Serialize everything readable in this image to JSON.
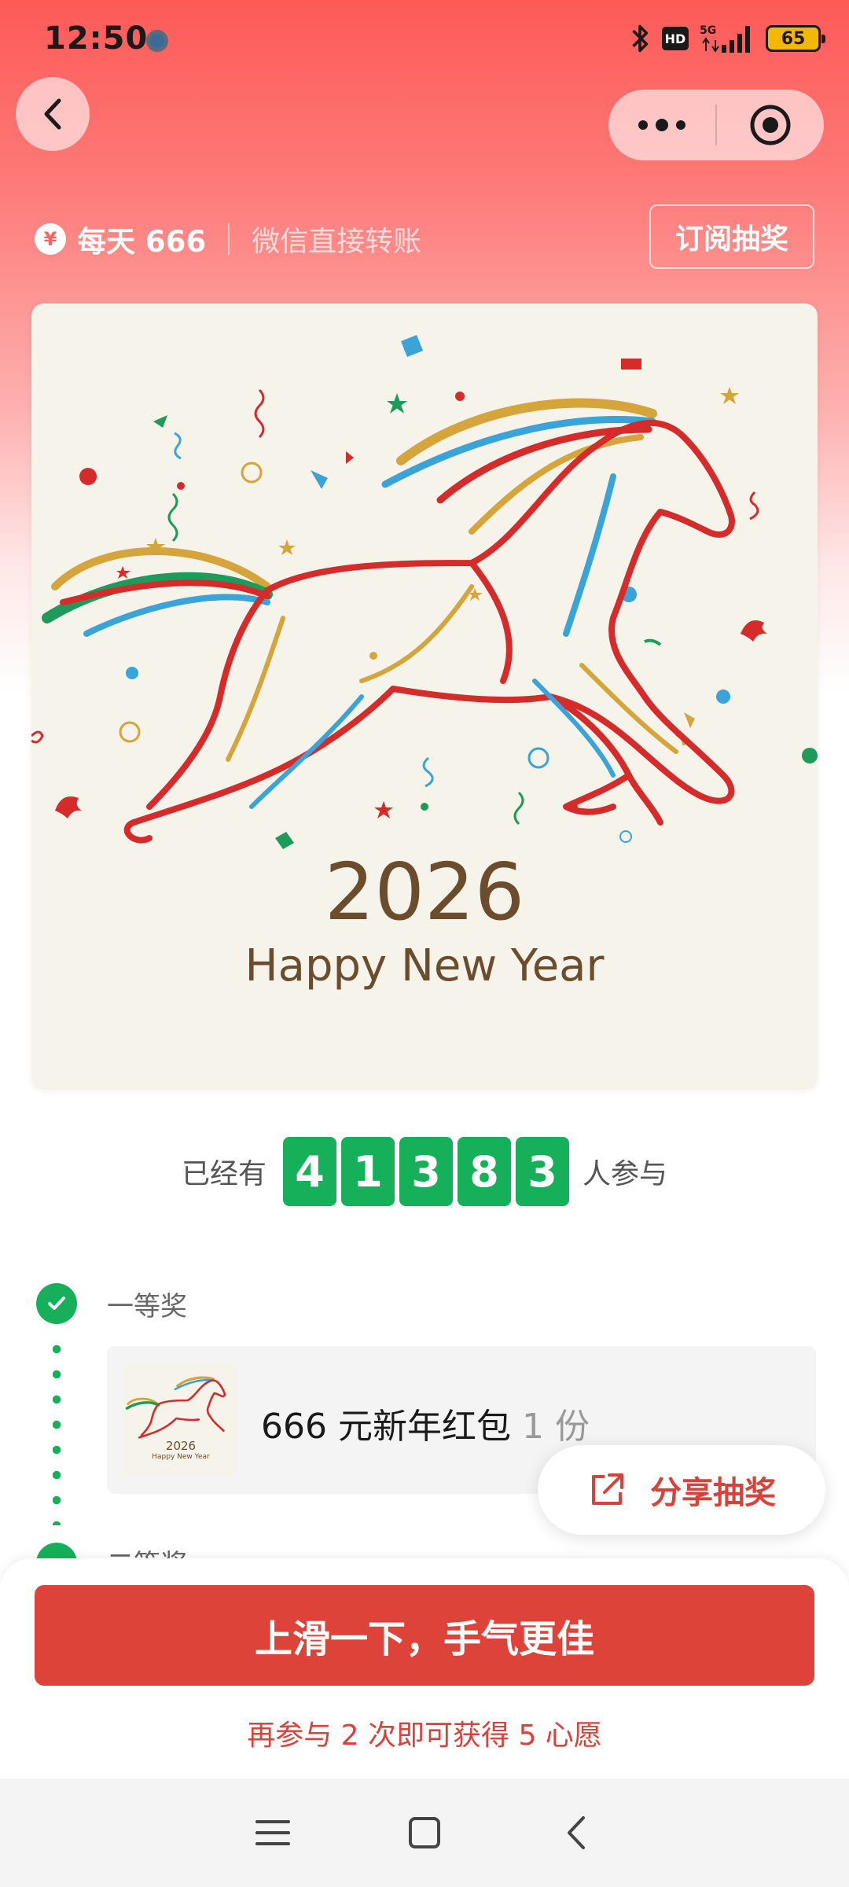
{
  "status_bar": {
    "time": "12:50",
    "network": "5G",
    "hd_badge": "HD",
    "battery": "65"
  },
  "header": {
    "back_icon": "chevron-left-icon",
    "more_icon": "more-dots-icon",
    "close_icon": "target-circle-icon"
  },
  "promo": {
    "icon": "yen-icon",
    "title": "每天 666",
    "subtitle": "微信直接转账",
    "subscribe_label": "订阅抽奖"
  },
  "poster": {
    "year": "2026",
    "greeting": "Happy New Year"
  },
  "counter": {
    "prefix": "已经有",
    "digits": [
      "4",
      "1",
      "3",
      "8",
      "3"
    ],
    "suffix": "人参与"
  },
  "prizes": [
    {
      "tier": "一等奖",
      "name": "666 元新年红包",
      "quantity": "1 份",
      "thumb_year": "2026",
      "thumb_greeting": "Happy New Year"
    },
    {
      "tier": "二等奖"
    }
  ],
  "share": {
    "icon": "share-icon",
    "label": "分享抽奖"
  },
  "cta": {
    "label": "上滑一下，手气更佳",
    "hint": "再参与 2 次即可获得 5 心愿"
  },
  "colors": {
    "brand_red": "#de4339",
    "accent_green": "#16b05a",
    "header_gradient_top": "#fd5a57"
  },
  "nav": {
    "menu_icon": "menu-icon",
    "home_icon": "home-square-icon",
    "back_icon": "back-triangle-icon"
  }
}
